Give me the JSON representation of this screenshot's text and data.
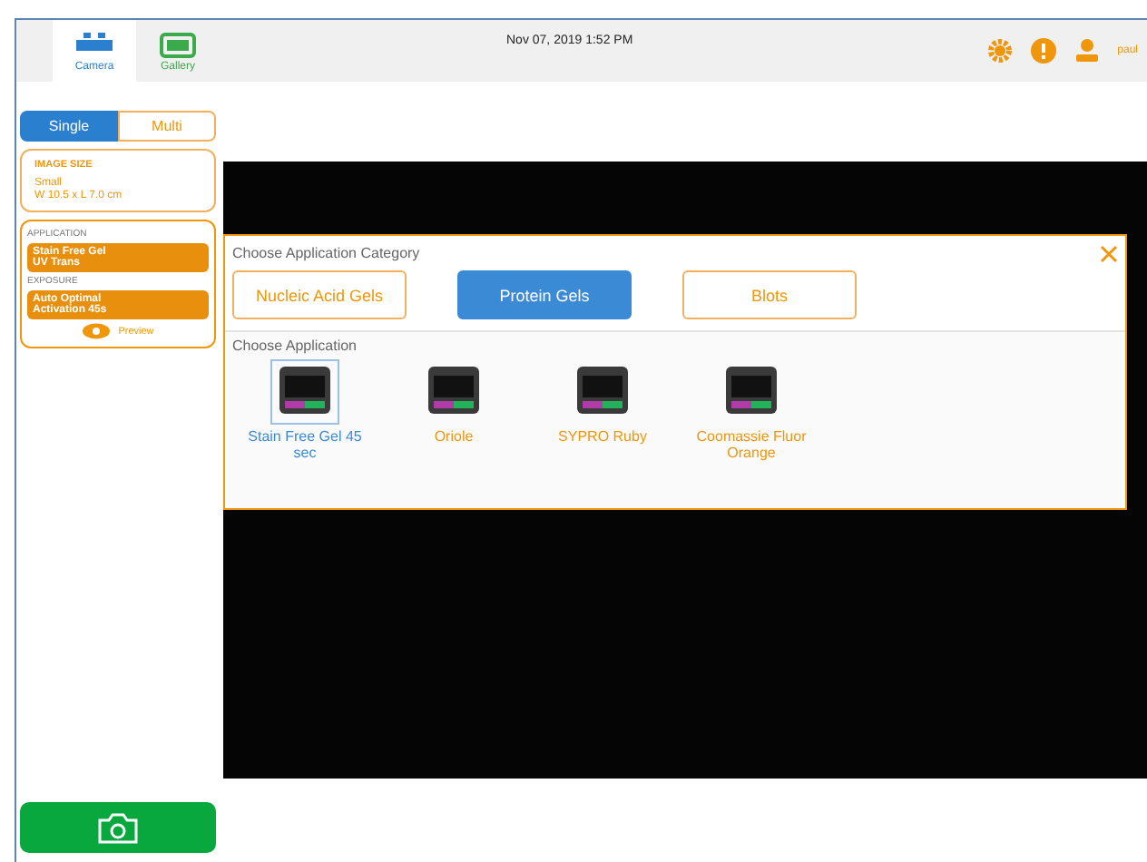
{
  "header": {
    "nav": [
      {
        "label": "Camera",
        "selected": true
      },
      {
        "label": "Gallery",
        "selected": false
      }
    ],
    "datetime": "Nov 07, 2019  1:52 PM",
    "user": "paul"
  },
  "sidebar": {
    "modes": [
      {
        "label": "Single",
        "selected": true
      },
      {
        "label": "Multi",
        "selected": false
      }
    ],
    "image_size": {
      "title": "IMAGE SIZE",
      "lines": [
        "Small",
        "W 10.5 x L 7.0 cm"
      ]
    },
    "application": {
      "title": "APPLICATION",
      "lines": [
        "Stain Free Gel",
        "UV Trans"
      ]
    },
    "exposure": {
      "title": "EXPOSURE",
      "lines": [
        "Auto Optimal",
        "Activation 45s"
      ]
    },
    "preview": "Preview"
  },
  "dialog": {
    "category_title": "Choose Application Category",
    "categories": [
      {
        "label": "Nucleic Acid Gels",
        "selected": false
      },
      {
        "label": "Protein Gels",
        "selected": true
      },
      {
        "label": "Blots",
        "selected": false
      }
    ],
    "application_title": "Choose Application",
    "applications": [
      {
        "label": "Stain Free Gel 45 sec",
        "selected": true
      },
      {
        "label": "Oriole",
        "selected": false
      },
      {
        "label": "SYPRO Ruby",
        "selected": false
      },
      {
        "label": "Coomassie Fluor Orange",
        "selected": false
      }
    ]
  }
}
